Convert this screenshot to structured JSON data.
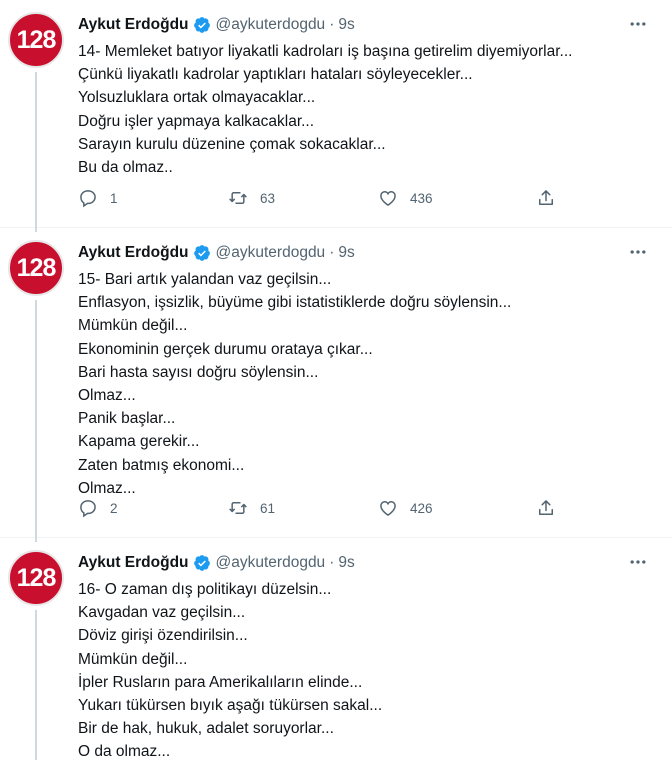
{
  "tweets": [
    {
      "avatar_text": "128",
      "name": "Aykut Erdoğdu",
      "handle": "@aykuterdogdu",
      "separator": "·",
      "time": "9s",
      "lines": [
        "14- Memleket batıyor liyakatli kadroları iş başına getirelim diyemiyorlar...",
        "Çünkü liyakatlı kadrolar yaptıkları hataları söyleyecekler...",
        "Yolsuzluklara ortak olmayacaklar...",
        "Doğru işler yapmaya kalkacaklar...",
        "Sarayın kurulu düzenine çomak sokacaklar...",
        "Bu da olmaz.."
      ],
      "replies": "1",
      "retweets": "63",
      "likes": "436"
    },
    {
      "avatar_text": "128",
      "name": "Aykut Erdoğdu",
      "handle": "@aykuterdogdu",
      "separator": "·",
      "time": "9s",
      "lines": [
        "15- Bari artık yalandan vaz geçilsin...",
        "Enflasyon, işsizlik, büyüme gibi istatistiklerde doğru söylensin...",
        "Mümkün değil...",
        "Ekonominin gerçek durumu orataya çıkar...",
        "Bari hasta sayısı doğru söylensin...",
        "Olmaz...",
        "Panik başlar...",
        "Kapama gerekir...",
        "Zaten batmış ekonomi...",
        "Olmaz..."
      ],
      "replies": "2",
      "retweets": "61",
      "likes": "426"
    },
    {
      "avatar_text": "128",
      "name": "Aykut Erdoğdu",
      "handle": "@aykuterdogdu",
      "separator": "·",
      "time": "9s",
      "lines": [
        "16- O zaman dış politikayı düzelsin...",
        "Kavgadan vaz geçilsin...",
        "Döviz girişi özendirilsin...",
        "Mümkün değil...",
        "İpler Rusların para Amerikalıların elinde...",
        "Yukarı tükürsen bıyık aşağı tükürsen sakal...",
        "Bir de hak, hukuk, adalet soruyorlar...",
        "O da olmaz..."
      ]
    }
  ],
  "colors": {
    "avatar_bg": "#c8102e",
    "verified": "#1d9bf0",
    "secondary_text": "#536471"
  }
}
